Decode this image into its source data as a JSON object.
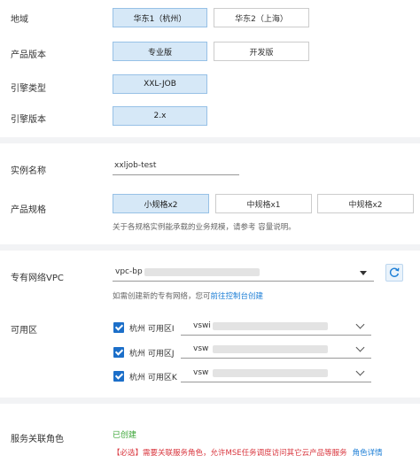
{
  "region": {
    "label": "地域",
    "options": [
      "华东1（杭州）",
      "华东2（上海）"
    ]
  },
  "product_version": {
    "label": "产品版本",
    "options": [
      "专业版",
      "开发版"
    ]
  },
  "engine_type": {
    "label": "引擎类型",
    "options": [
      "XXL-JOB"
    ]
  },
  "engine_version": {
    "label": "引擎版本",
    "options": [
      "2.x"
    ]
  },
  "instance_name": {
    "label": "实例名称",
    "value": "xxljob-test"
  },
  "spec": {
    "label": "产品规格",
    "options": [
      "小规格x2",
      "中规格x1",
      "中规格x2"
    ],
    "hint": "关于各规格实例能承载的业务规模，请参考 容量说明。"
  },
  "vpc": {
    "label": "专有网络VPC",
    "value": "vpc-bp",
    "hint_prefix": "如需创建新的专有网络，您可",
    "hint_link": "前往控制台创建"
  },
  "zone": {
    "label": "可用区",
    "items": [
      {
        "name": "杭州 可用区I",
        "vswitch": "vswi"
      },
      {
        "name": "杭州 可用区J",
        "vswitch": "vsw"
      },
      {
        "name": "杭州 可用区K",
        "vswitch": "vsw"
      }
    ]
  },
  "service_role": {
    "label": "服务关联角色",
    "status": "已创建",
    "notice": "【必选】需要关联服务角色，允许MSE任务调度访问其它云产品等服务",
    "link": "角色详情"
  },
  "colors": {
    "accent": "#1c7ed6",
    "selected_bg": "#d6e8f7",
    "created_green": "#3aa536",
    "required_red": "#d9363e"
  }
}
